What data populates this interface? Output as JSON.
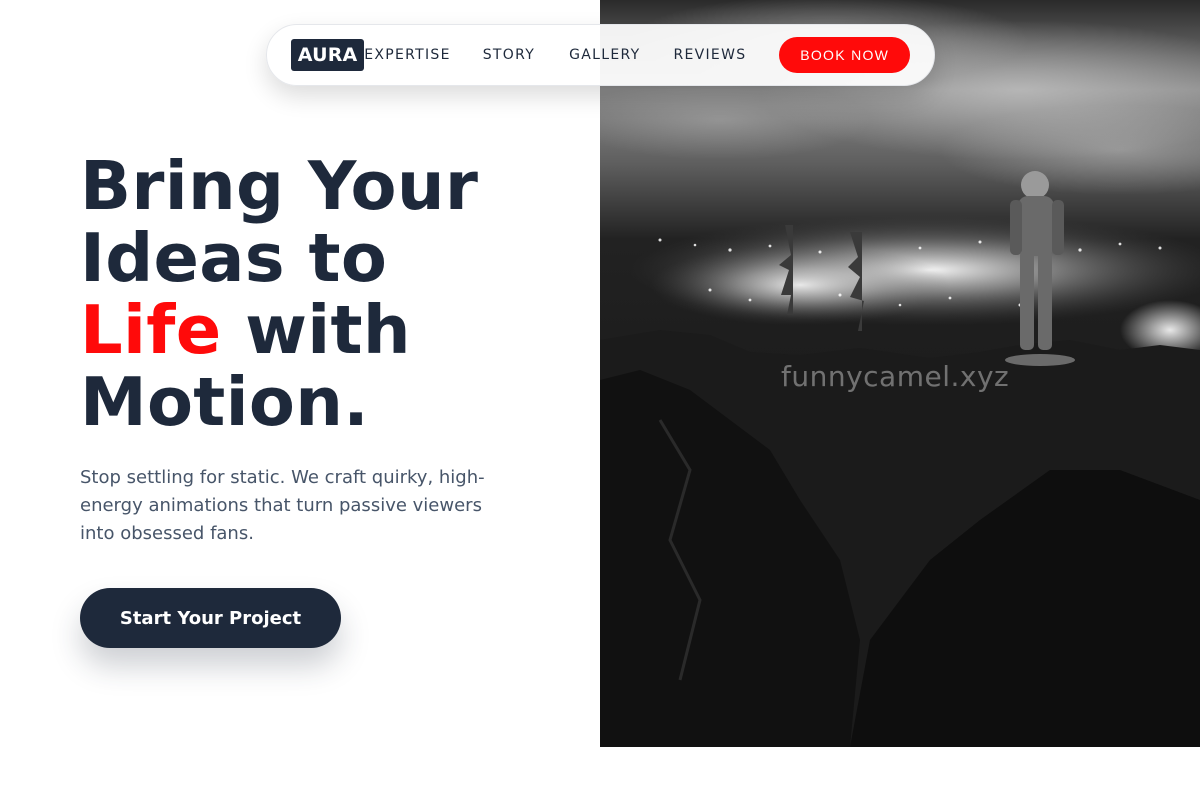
{
  "nav": {
    "logo": "AURA",
    "links": [
      "EXPERTISE",
      "STORY",
      "GALLERY",
      "REVIEWS"
    ],
    "book_label": "BOOK NOW"
  },
  "hero": {
    "headline_line1": "Bring Your",
    "headline_line2": "Ideas to",
    "headline_accent": "Life",
    "headline_line3_rest": " with",
    "headline_line4": "Motion.",
    "subtext": "Stop settling for static. We craft quirky, high-energy animations that turn passive viewers into obsessed fans.",
    "cta_label": "Start Your Project"
  },
  "photo": {
    "watermark": "funnycamel.xyz",
    "description_icon": "astronaut-cliff-city-lights-photo"
  },
  "colors": {
    "primary_dark": "#1e293b",
    "accent_red": "#ff0a0a",
    "body_text": "#475569"
  }
}
